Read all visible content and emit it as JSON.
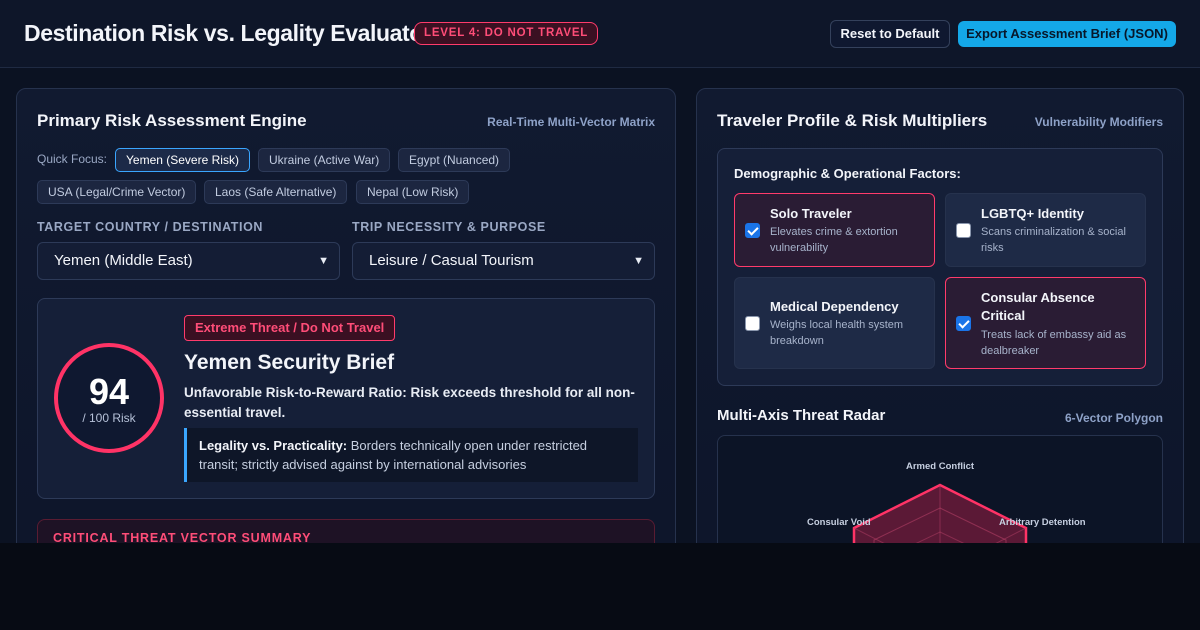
{
  "header": {
    "title": "Destination Risk vs. Legality Evaluator",
    "level_badge": "LEVEL 4: DO NOT TRAVEL",
    "reset_label": "Reset to Default",
    "export_label": "Export Assessment Brief (JSON)"
  },
  "left_panel": {
    "title": "Primary Risk Assessment Engine",
    "subtitle": "Real-Time Multi-Vector Matrix",
    "quick_focus_label": "Quick Focus:",
    "chips": [
      {
        "label": "Yemen (Severe Risk)",
        "active": true
      },
      {
        "label": "Ukraine (Active War)",
        "active": false
      },
      {
        "label": "Egypt (Nuanced)",
        "active": false
      },
      {
        "label": "USA (Legal/Crime Vector)",
        "active": false
      },
      {
        "label": "Laos (Safe Alternative)",
        "active": false
      },
      {
        "label": "Nepal (Low Risk)",
        "active": false
      }
    ],
    "country_label": "TARGET COUNTRY / DESTINATION",
    "country_value": "Yemen (Middle East)",
    "purpose_label": "TRIP NECESSITY & PURPOSE",
    "purpose_value": "Leisure / Casual Tourism",
    "brief": {
      "score": "94",
      "score_label": "/ 100 Risk",
      "threat_badge": "Extreme Threat / Do Not Travel",
      "title": "Yemen Security Brief",
      "verdict": "Unfavorable Risk-to-Reward Ratio: Risk exceeds threshold for all non-essential travel.",
      "note_label": "Legality vs. Practicality:",
      "note_text": " Borders technically open under restricted transit; strictly advised against by international advisories"
    },
    "summary_title": "CRITICAL THREAT VECTOR SUMMARY"
  },
  "right_panel": {
    "title": "Traveler Profile & Risk Multipliers",
    "subtitle": "Vulnerability Modifiers",
    "factors_title": "Demographic & Operational Factors:",
    "factors": [
      {
        "name": "Solo Traveler",
        "desc": "Elevates crime & extortion vulnerability",
        "checked": true
      },
      {
        "name": "LGBTQ+ Identity",
        "desc": "Scans criminalization & social risks",
        "checked": false
      },
      {
        "name": "Medical Dependency",
        "desc": "Weighs local health system breakdown",
        "checked": false
      },
      {
        "name": "Consular Absence Critical",
        "desc": "Treats lack of embassy aid as dealbreaker",
        "checked": true
      }
    ],
    "radar_title": "Multi-Axis Threat Radar",
    "radar_subtitle": "6-Vector Polygon",
    "radar_axes": [
      "Armed Conflict",
      "Arbitrary Detention",
      "Consular Void"
    ]
  },
  "colors": {
    "accent_red": "#ff3366",
    "accent_blue": "#14a8e8"
  }
}
